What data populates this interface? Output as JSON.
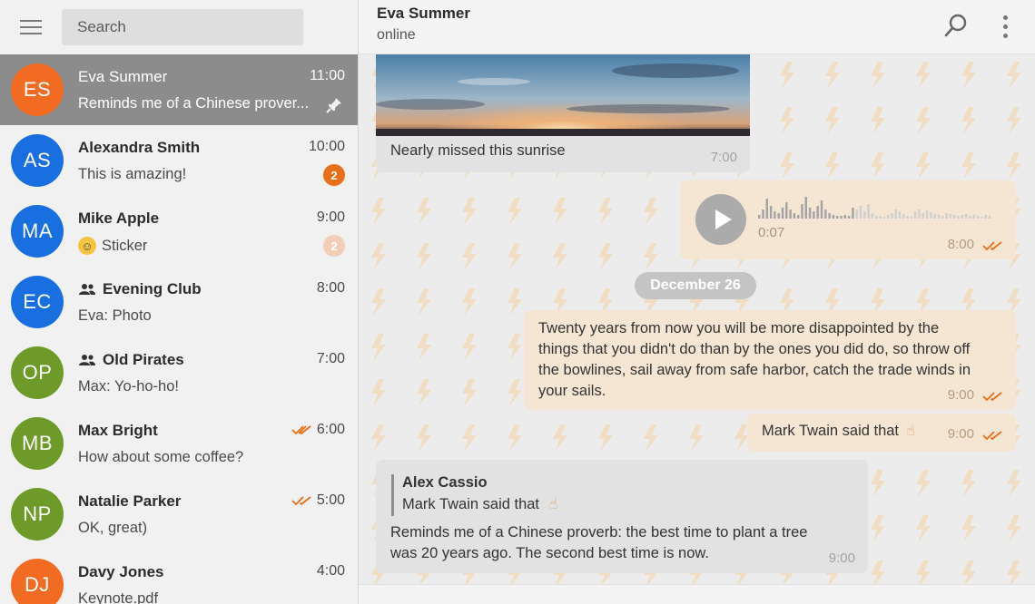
{
  "colors": {
    "accent_orange": "#e8701a",
    "sidebar_bg": "#f1f1f1",
    "active_chat_bg": "#8c8c8c",
    "incoming_bubble": "#e2e2e2",
    "outgoing_bubble": "#f4e6d2",
    "date_pill": "#c4c4c4",
    "read_ticks": "#e8701a"
  },
  "sidebar": {
    "search_placeholder": "Search",
    "chats": [
      {
        "initials": "ES",
        "name": "Eva Summer",
        "time": "11:00",
        "preview": "Reminds me of a Chinese prover...",
        "avatar_color": "#f26b22",
        "pinned": true,
        "active": true
      },
      {
        "initials": "AS",
        "name": "Alexandra Smith",
        "time": "10:00",
        "preview": "This is amazing!",
        "avatar_color": "#1a6fe0",
        "badge": "2",
        "badge_color": "#e8701a"
      },
      {
        "initials": "MA",
        "name": "Mike Apple",
        "time": "9:00",
        "preview": "Sticker",
        "avatar_color": "#1a6fe0",
        "badge": "2",
        "badge_color": "#f2cdb8",
        "preview_icon": "smiley-icon"
      },
      {
        "initials": "EC",
        "name": "Evening Club",
        "time": "8:00",
        "preview": "Eva: Photo",
        "avatar_color": "#1a6fe0",
        "group": true
      },
      {
        "initials": "OP",
        "name": "Old Pirates",
        "time": "7:00",
        "preview": "Max: Yo-ho-ho!",
        "avatar_color": "#6d9a28",
        "group": true
      },
      {
        "initials": "MB",
        "name": "Max Bright",
        "time": "6:00",
        "preview": "How about some coffee?",
        "avatar_color": "#6d9a28",
        "read_ticks": true
      },
      {
        "initials": "NP",
        "name": "Natalie Parker",
        "time": "5:00",
        "preview": "OK, great)",
        "avatar_color": "#6d9a28",
        "read_ticks": true
      },
      {
        "initials": "DJ",
        "name": "Davy Jones",
        "time": "4:00",
        "preview": "Keynote.pdf",
        "avatar_color": "#f26b22"
      }
    ]
  },
  "header": {
    "name": "Eva Summer",
    "status": "online",
    "icons": [
      "search-icon",
      "more-vert-icon"
    ]
  },
  "messages": {
    "photo": {
      "caption": "Nearly missed this sunrise",
      "time": "7:00"
    },
    "voice": {
      "duration": "0:07",
      "time": "8:00"
    },
    "date_separator": "December 26",
    "quote": {
      "lines": [
        "Twenty years from now you will be more disappointed by the",
        "things that you didn't do than by the ones you did do, so throw off",
        "the bowlines, sail away from safe harbor, catch the trade winds in",
        "your sails."
      ],
      "time": "9:00"
    },
    "twain": {
      "text": "Mark Twain said that",
      "emoji": "☝",
      "time": "9:00"
    },
    "reply": {
      "reply_name": "Alex Cassio",
      "reply_text": "Mark Twain said that",
      "reply_emoji": "☝",
      "lines": [
        "Reminds me of a Chinese proverb: the best time to plant a tree",
        "was 20 years ago. The second best time is now."
      ],
      "time": "9:00"
    }
  }
}
